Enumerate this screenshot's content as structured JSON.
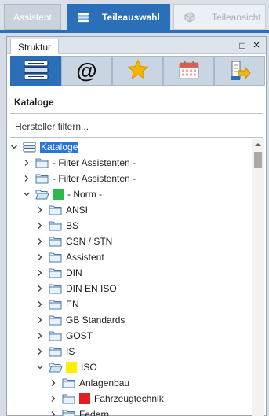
{
  "tabs": [
    {
      "label": "Assistent",
      "state": "inactive"
    },
    {
      "label": "Teileauswahl",
      "state": "active",
      "icon": "stacked-books-icon"
    },
    {
      "label": "Teileansicht",
      "state": "disabled",
      "icon": "cube-icon"
    }
  ],
  "panel": {
    "tab_label": "Struktur",
    "maximize_symbol": "□",
    "close_symbol": "×"
  },
  "toolbar": {
    "buttons": [
      {
        "icon": "catalog-books-icon",
        "state": "active"
      },
      {
        "icon": "at-sign-icon",
        "glyph": "@"
      },
      {
        "icon": "star-icon"
      },
      {
        "icon": "calendar-icon"
      },
      {
        "icon": "export-icon"
      }
    ]
  },
  "section": {
    "label": "Kataloge"
  },
  "filter": {
    "placeholder": "Hersteller filtern...",
    "value": ""
  },
  "tree": {
    "items": [
      {
        "label": "Kataloge",
        "expanded": true,
        "selected": true
      },
      {
        "label": "- Filter Assistenten -"
      },
      {
        "label": "- Filter Assistenten -"
      },
      {
        "label": "- Norm -",
        "expanded": true,
        "marker_color": "#2db84d"
      },
      {
        "label": "ANSI"
      },
      {
        "label": "BS"
      },
      {
        "label": "CSN / STN"
      },
      {
        "label": "Assistent"
      },
      {
        "label": "DIN"
      },
      {
        "label": "DIN EN ISO"
      },
      {
        "label": "EN"
      },
      {
        "label": "GB Standards"
      },
      {
        "label": "GOST"
      },
      {
        "label": "IS"
      },
      {
        "label": "ISO",
        "expanded": true,
        "marker_color": "#ffee00"
      },
      {
        "label": "Anlagenbau"
      },
      {
        "label": "Fahrzeugtechnik",
        "marker_color": "#e02020"
      },
      {
        "label": "Federn"
      }
    ]
  },
  "colors": {
    "accent": "#2a6fb7",
    "selection": "#2a74d6"
  }
}
